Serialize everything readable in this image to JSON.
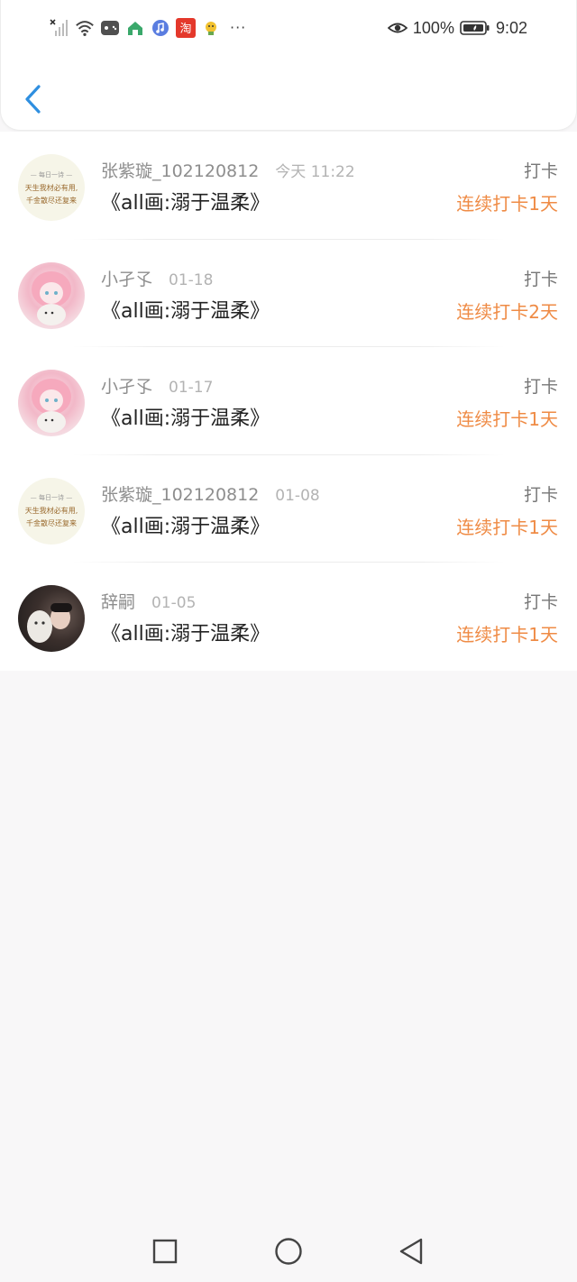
{
  "status_bar": {
    "left_icons": [
      "signal-off-icon",
      "wifi-icon",
      "game-app-icon",
      "home-app-icon",
      "music-app-icon",
      "taobao-app-icon",
      "bulb-app-icon"
    ],
    "more_indicator": "···",
    "battery_percent": "100%",
    "time": "9:02"
  },
  "header": {
    "back_icon": "chevron-left-icon"
  },
  "colors": {
    "accent_blue": "#2f8fe0",
    "streak_orange": "#ef8b45"
  },
  "avatars": {
    "poem": {
      "heading": "— 每日一诗 —",
      "line1": "天生我材必有用,",
      "line2": "千金散尽还复来"
    }
  },
  "entries": [
    {
      "name": "张紫璇_102120812",
      "time": "今天 11:22",
      "title": "《all画:溺于温柔》",
      "tag": "打卡",
      "streak": "连续打卡1天",
      "avatar": "poem"
    },
    {
      "name": "小孑孓",
      "time": "01-18",
      "title": "《all画:溺于温柔》",
      "tag": "打卡",
      "streak": "连续打卡2天",
      "avatar": "pink"
    },
    {
      "name": "小孑孓",
      "time": "01-17",
      "title": "《all画:溺于温柔》",
      "tag": "打卡",
      "streak": "连续打卡1天",
      "avatar": "pink"
    },
    {
      "name": "张紫璇_102120812",
      "time": "01-08",
      "title": "《all画:溺于温柔》",
      "tag": "打卡",
      "streak": "连续打卡1天",
      "avatar": "poem"
    },
    {
      "name": "辞嗣",
      "time": "01-05",
      "title": "《all画:溺于温柔》",
      "tag": "打卡",
      "streak": "连续打卡1天",
      "avatar": "dark"
    }
  ],
  "nav_bar": {
    "buttons": [
      "square-recents-icon",
      "circle-home-icon",
      "triangle-back-icon"
    ]
  }
}
